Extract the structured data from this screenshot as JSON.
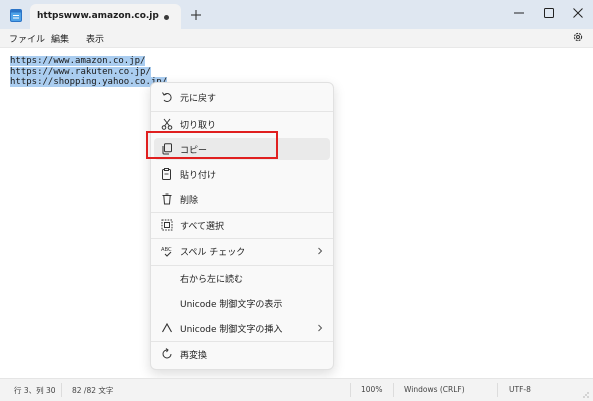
{
  "window": {
    "tab_title": "httpswww.amazon.co.jp",
    "app_icon": "notepad-icon",
    "controls": [
      "minimize-icon",
      "maximize-icon",
      "close-icon"
    ]
  },
  "menubar": {
    "file": "ファイル",
    "edit": "編集",
    "view": "表示",
    "settings_icon": "gear-icon"
  },
  "editor": {
    "lines": [
      "https://www.amazon.co.jp/",
      "https://www.rakuten.co.jp/",
      "https://shopping.yahoo.co.jp/"
    ]
  },
  "context_menu": {
    "items": [
      {
        "label": "元に戻す",
        "icon": "undo-icon"
      },
      {
        "label": "切り取り",
        "icon": "scissors-icon"
      },
      {
        "label": "コピー",
        "icon": "copy-icon",
        "hovered": true
      },
      {
        "label": "貼り付け",
        "icon": "paste-icon"
      },
      {
        "label": "削除",
        "icon": "trash-icon"
      },
      {
        "label": "すべて選択",
        "icon": "select-all-icon"
      },
      {
        "label": "スペル チェック",
        "icon": "spellcheck-icon",
        "submenu": true
      },
      {
        "label": "右から左に読む",
        "icon": ""
      },
      {
        "label": "Unicode 制御文字の表示",
        "icon": ""
      },
      {
        "label": "Unicode 制御文字の挿入",
        "icon": "insert-caret-icon",
        "submenu": true
      },
      {
        "label": "再変換",
        "icon": "reconvert-icon"
      }
    ]
  },
  "statusbar": {
    "position": "行 3、列 30",
    "chars": "82 /82 文字",
    "zoom": "100%",
    "line_ending": "Windows (CRLF)",
    "encoding": "UTF-8"
  },
  "colors": {
    "highlight_box": "#e01f1f",
    "selection": "#aacdf0",
    "titlebar": "#dfe7f1"
  }
}
